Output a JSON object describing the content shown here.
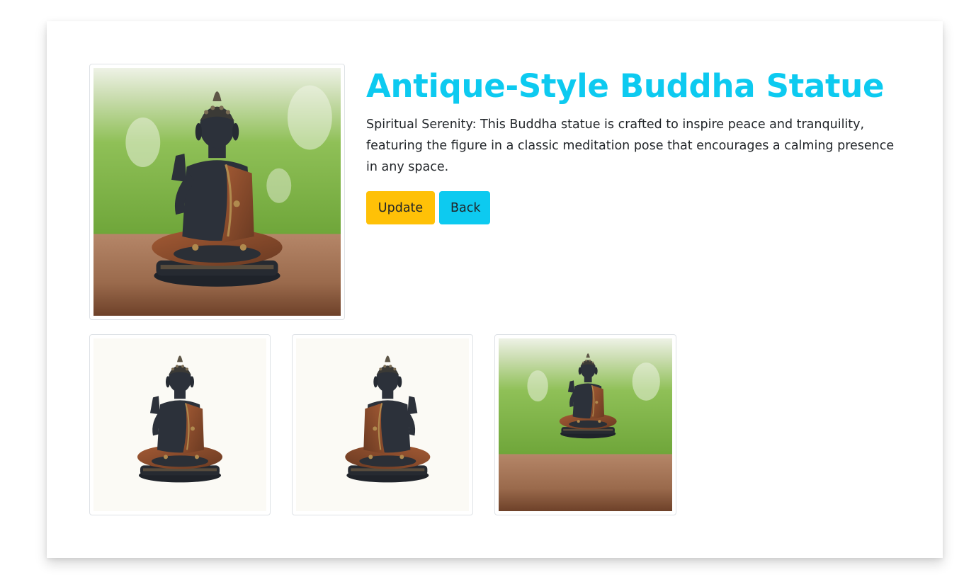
{
  "product": {
    "title": "Antique-Style Buddha Statue",
    "description": "Spiritual Serenity: This Buddha statue is crafted to inspire peace and tranquility, featuring the figure in a classic meditation pose that encourages a calming presence in any space."
  },
  "actions": {
    "update_label": "Update",
    "back_label": "Back"
  },
  "images": {
    "main": "buddha-statue-garden-photo",
    "gallery": [
      "buddha-statue-front-white-background",
      "buddha-statue-side-white-background",
      "buddha-statue-garden-photo"
    ]
  },
  "colors": {
    "title": "#0dcaf0",
    "update_button": "#ffc107",
    "back_button": "#0dcaf0",
    "text": "#212529"
  }
}
